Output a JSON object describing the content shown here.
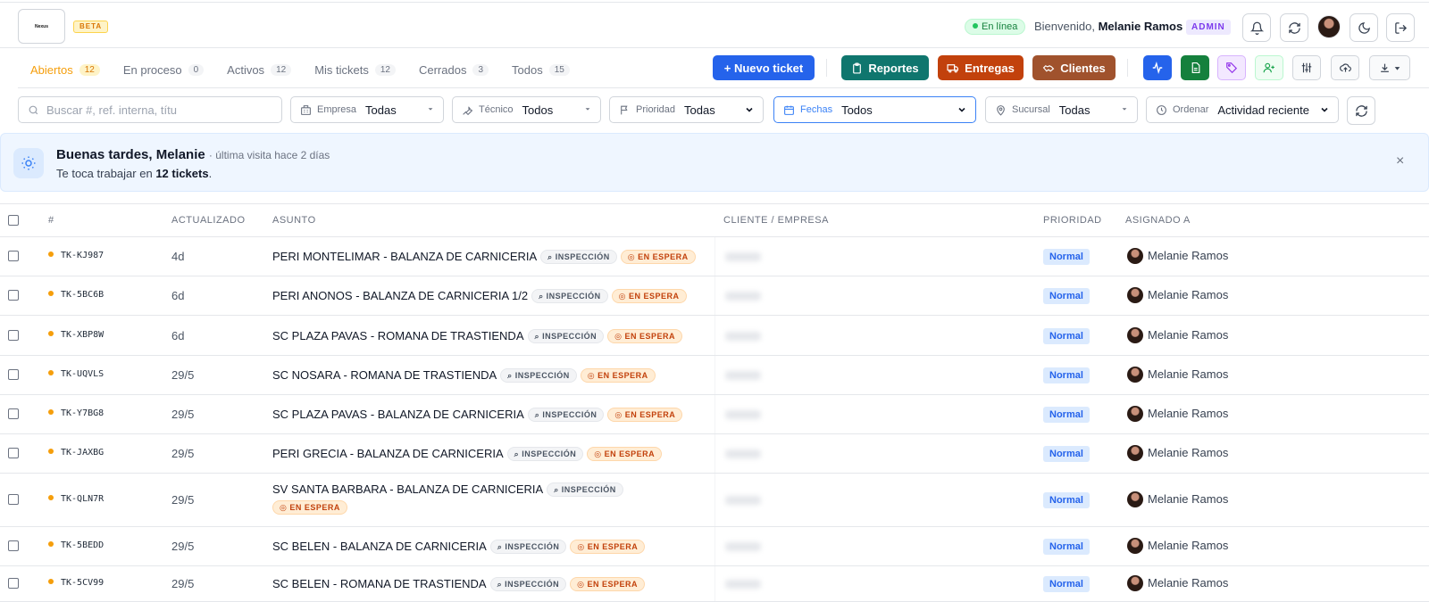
{
  "header": {
    "logo_text": "Nexus",
    "beta": "BETA",
    "status": "En línea",
    "welcome_prefix": "Bienvenido,",
    "user_name": "Melanie Ramos",
    "role": "ADMIN"
  },
  "tabs": [
    {
      "label": "Abiertos",
      "count": "12"
    },
    {
      "label": "En proceso",
      "count": "0"
    },
    {
      "label": "Activos",
      "count": "12"
    },
    {
      "label": "Mis tickets",
      "count": "12"
    },
    {
      "label": "Cerrados",
      "count": "3"
    },
    {
      "label": "Todos",
      "count": "15"
    }
  ],
  "actions": {
    "new_ticket": "+ Nuevo ticket",
    "reports": "Reportes",
    "deliveries": "Entregas",
    "clients": "Clientes"
  },
  "colors": {
    "accent_blue": "#2563eb",
    "reports_green": "#0f766e",
    "deliveries_orange": "#c2410c",
    "clients_brown": "#a0522d"
  },
  "filters": {
    "search_placeholder": "Buscar #, ref. interna, títu",
    "empresa": {
      "label": "Empresa",
      "value": "Todas"
    },
    "tecnico": {
      "label": "Técnico",
      "value": "Todos"
    },
    "prioridad": {
      "label": "Prioridad",
      "value": "Todas"
    },
    "fechas": {
      "label": "Fechas",
      "value": "Todos"
    },
    "sucursal": {
      "label": "Sucursal",
      "value": "Todas"
    },
    "ordenar": {
      "label": "Ordenar",
      "value": "Actividad reciente"
    }
  },
  "banner": {
    "greeting": "Buenas tardes, Melanie",
    "last_visit": "· última visita hace 2 días",
    "sub_prefix": "Te toca trabajar en",
    "sub_count": "12 tickets",
    "sub_suffix": "."
  },
  "table": {
    "columns": {
      "id": "#",
      "updated": "ACTUALIZADO",
      "subject": "ASUNTO",
      "client": "CLIENTE / EMPRESA",
      "priority": "PRIORIDAD",
      "assigned": "ASIGNADO A"
    },
    "badge_inspection": "INSPECCIÓN",
    "badge_waiting": "EN ESPERA",
    "rows": [
      {
        "id": "TK-KJ987",
        "updated": "4d",
        "subject": "PERI MONTELIMAR - BALANZA DE CARNICERIA",
        "priority": "Normal",
        "assignee": "Melanie Ramos"
      },
      {
        "id": "TK-5BC6B",
        "updated": "6d",
        "subject": "PERI ANONOS - BALANZA DE CARNICERIA 1/2",
        "priority": "Normal",
        "assignee": "Melanie Ramos"
      },
      {
        "id": "TK-XBP8W",
        "updated": "6d",
        "subject": "SC PLAZA PAVAS - ROMANA DE TRASTIENDA",
        "priority": "Normal",
        "assignee": "Melanie Ramos"
      },
      {
        "id": "TK-UQVLS",
        "updated": "29/5",
        "subject": "SC NOSARA - ROMANA DE TRASTIENDA",
        "priority": "Normal",
        "assignee": "Melanie Ramos"
      },
      {
        "id": "TK-Y7BG8",
        "updated": "29/5",
        "subject": "SC PLAZA PAVAS - BALANZA DE CARNICERIA",
        "priority": "Normal",
        "assignee": "Melanie Ramos"
      },
      {
        "id": "TK-JAXBG",
        "updated": "29/5",
        "subject": "PERI GRECIA - BALANZA DE CARNICERIA",
        "priority": "Normal",
        "assignee": "Melanie Ramos"
      },
      {
        "id": "TK-QLN7R",
        "updated": "29/5",
        "subject": "SV SANTA BARBARA - BALANZA DE CARNICERIA",
        "priority": "Normal",
        "assignee": "Melanie Ramos"
      },
      {
        "id": "TK-5BEDD",
        "updated": "29/5",
        "subject": "SC BELEN - BALANZA DE CARNICERIA",
        "priority": "Normal",
        "assignee": "Melanie Ramos"
      },
      {
        "id": "TK-5CV99",
        "updated": "29/5",
        "subject": "SC BELEN - ROMANA DE TRASTIENDA",
        "priority": "Normal",
        "assignee": "Melanie Ramos"
      }
    ]
  }
}
